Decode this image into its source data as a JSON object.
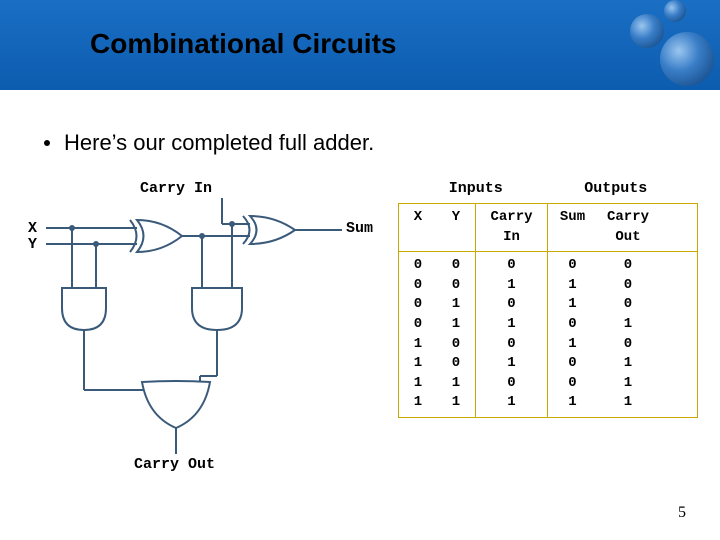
{
  "header": {
    "title": "Combinational Circuits"
  },
  "bullet": "Here’s our completed full adder.",
  "diagram": {
    "labels": {
      "carry_in": "Carry In",
      "x": "X",
      "y": "Y",
      "sum": "Sum",
      "carry_out": "Carry Out"
    }
  },
  "truth": {
    "head_inputs": "Inputs",
    "head_outputs": "Outputs",
    "cols": {
      "x": "X",
      "y": "Y",
      "cin": "Carry\nIn",
      "sum": "Sum",
      "cout": "Carry\nOut"
    },
    "rows": [
      {
        "x": 0,
        "y": 0,
        "cin": 0,
        "sum": 0,
        "cout": 0
      },
      {
        "x": 0,
        "y": 0,
        "cin": 1,
        "sum": 1,
        "cout": 0
      },
      {
        "x": 0,
        "y": 1,
        "cin": 0,
        "sum": 1,
        "cout": 0
      },
      {
        "x": 0,
        "y": 1,
        "cin": 1,
        "sum": 0,
        "cout": 1
      },
      {
        "x": 1,
        "y": 0,
        "cin": 0,
        "sum": 1,
        "cout": 0
      },
      {
        "x": 1,
        "y": 0,
        "cin": 1,
        "sum": 0,
        "cout": 1
      },
      {
        "x": 1,
        "y": 1,
        "cin": 0,
        "sum": 0,
        "cout": 1
      },
      {
        "x": 1,
        "y": 1,
        "cin": 1,
        "sum": 1,
        "cout": 1
      }
    ]
  },
  "page_number": "5"
}
